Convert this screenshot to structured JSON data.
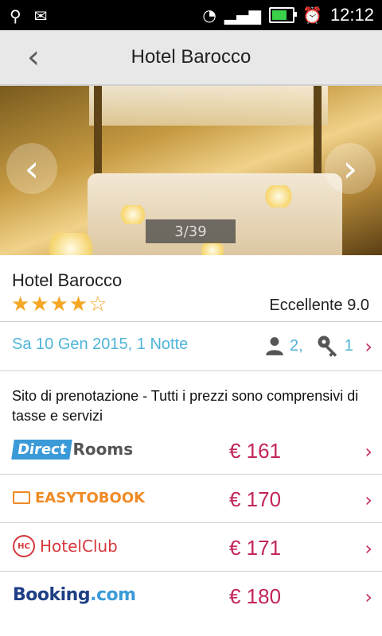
{
  "status_bar": {
    "time": "12:12",
    "icons": [
      "usb-icon",
      "sms-icon",
      "wifi-icon",
      "signal-icon",
      "battery-icon",
      "alarm-icon"
    ]
  },
  "app_bar": {
    "title": "Hotel Barocco",
    "back_icon": "back-chevron-icon"
  },
  "gallery": {
    "counter": "3/39",
    "prev_icon": "chevron-left-icon",
    "next_icon": "chevron-right-icon"
  },
  "hotel": {
    "name": "Hotel Barocco",
    "stars": "★★★★☆",
    "rating_text": "Eccellente 9.0",
    "rating_value": 9.0,
    "star_count": 4
  },
  "booking": {
    "date": "Sa 10 Gen 2015, 1 Notte",
    "guests": "2,",
    "rooms": "1"
  },
  "offers_header": "Sito di prenotazione - Tutti i prezzi sono comprensivi di tasse e servizi",
  "offers": [
    {
      "site_a": "Direct",
      "site_b": "Rooms",
      "price": "€ 161"
    },
    {
      "site": "EASYTOBOOK",
      "price": "€ 170"
    },
    {
      "site_icon": "HC",
      "site": "HotelClub",
      "price": "€ 171"
    },
    {
      "site_a": "Booking",
      "site_b": ".com",
      "price": "€ 180"
    }
  ],
  "colors": {
    "accent_blue": "#4fb5d8",
    "price_pink": "#c2255c",
    "star_orange": "#f5a623"
  }
}
